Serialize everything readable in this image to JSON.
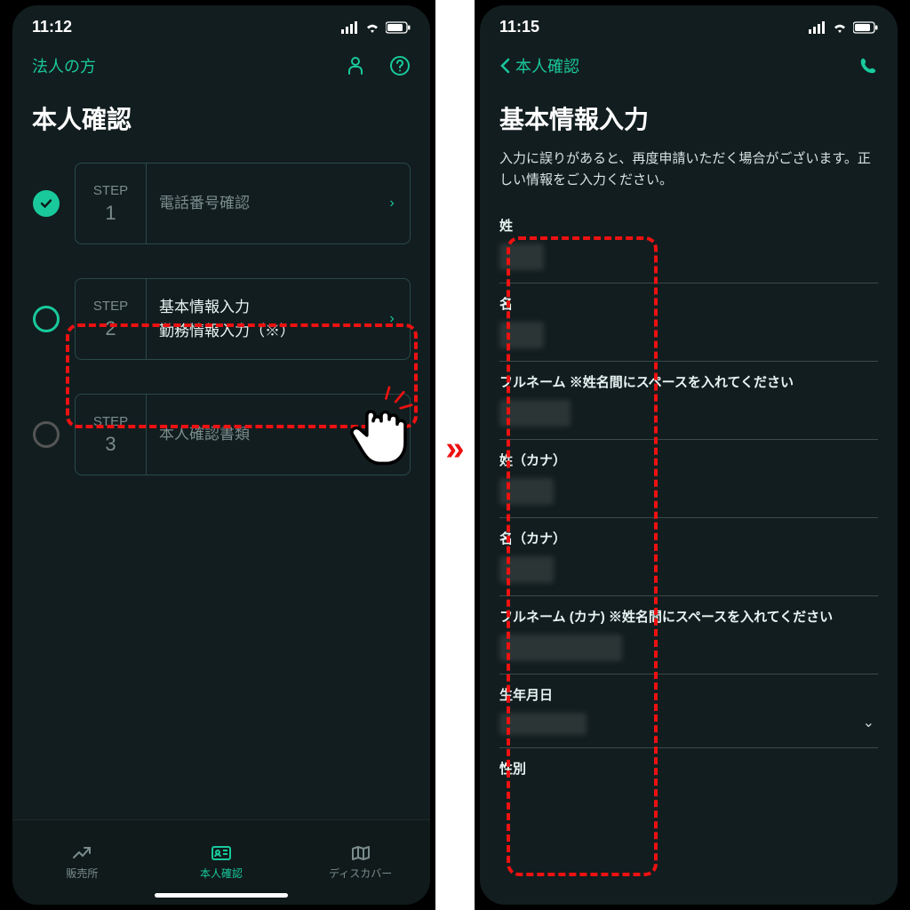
{
  "left": {
    "status_time": "11:12",
    "corp_link": "法人の方",
    "page_title": "本人確認",
    "steps": [
      {
        "label": "STEP",
        "num": "1",
        "text": "電話番号確認"
      },
      {
        "label": "STEP",
        "num": "2",
        "text": "基本情報入力\n勤務情報入力（※）"
      },
      {
        "label": "STEP",
        "num": "3",
        "text": "本人確認書類"
      }
    ],
    "tabs": {
      "sell": "販売所",
      "verify": "本人確認",
      "discover": "ディスカバー"
    }
  },
  "right": {
    "status_time": "11:15",
    "back_label": "本人確認",
    "page_title": "基本情報入力",
    "subtitle": "入力に誤りがあると、再度申請いただく場合がございます。正しい情報をご入力ください。",
    "fields": {
      "lastname": "姓",
      "firstname": "名",
      "fullname": "フルネーム ※姓名間にスペースを入れてください",
      "lastname_kana": "姓（カナ）",
      "firstname_kana": "名（カナ）",
      "fullname_kana": "フルネーム (カナ) ※姓名間にスペースを入れてください",
      "dob": "生年月日",
      "gender": "性別"
    }
  }
}
